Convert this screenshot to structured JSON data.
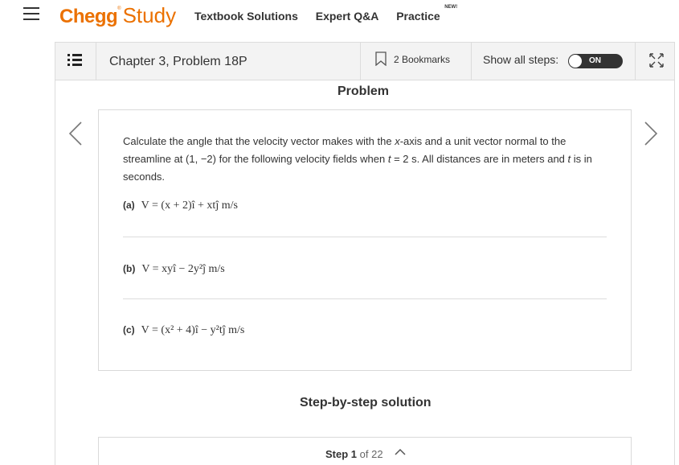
{
  "nav": {
    "logo_chegg": "Chegg",
    "logo_reg": "®",
    "logo_study": "Study",
    "links": [
      "Textbook Solutions",
      "Expert Q&A",
      "Practice"
    ],
    "new_badge": "NEW!"
  },
  "toolbar": {
    "chapter_title": "Chapter 3, Problem 18P",
    "bookmarks_label": "2 Bookmarks",
    "show_all_label": "Show all steps:",
    "toggle_label": "ON"
  },
  "problem": {
    "heading": "Problem",
    "text_before": "Calculate the angle that the velocity vector makes with the ",
    "text_x": "x",
    "text_mid": "-axis and a unit vector normal to the streamline at (1, −2) for the following velocity fields when ",
    "text_t": "t",
    "text_after": " = 2 s. All distances are in meters and ",
    "text_t2": "t",
    "text_end": " is in seconds.",
    "parts": [
      {
        "label": "(a)",
        "equation": "V = (x + 2)î + xtĵ m/s"
      },
      {
        "label": "(b)",
        "equation": "V = xyî − 2y²ĵ m/s"
      },
      {
        "label": "(c)",
        "equation": "V = (x² + 4)î − y²tĵ m/s"
      }
    ]
  },
  "steps": {
    "heading": "Step-by-step solution",
    "step_word": "Step",
    "current": "1",
    "of_word": "of",
    "total": "22"
  },
  "icons": {
    "menu": "hamburger-icon",
    "list": "list-icon",
    "bookmark": "bookmark-icon",
    "expand": "expand-icon",
    "prev": "chevron-left-icon",
    "next": "chevron-right-icon",
    "collapse": "chevron-up-icon"
  },
  "colors": {
    "brand": "#eb7100",
    "toggle_bg": "#333333"
  }
}
